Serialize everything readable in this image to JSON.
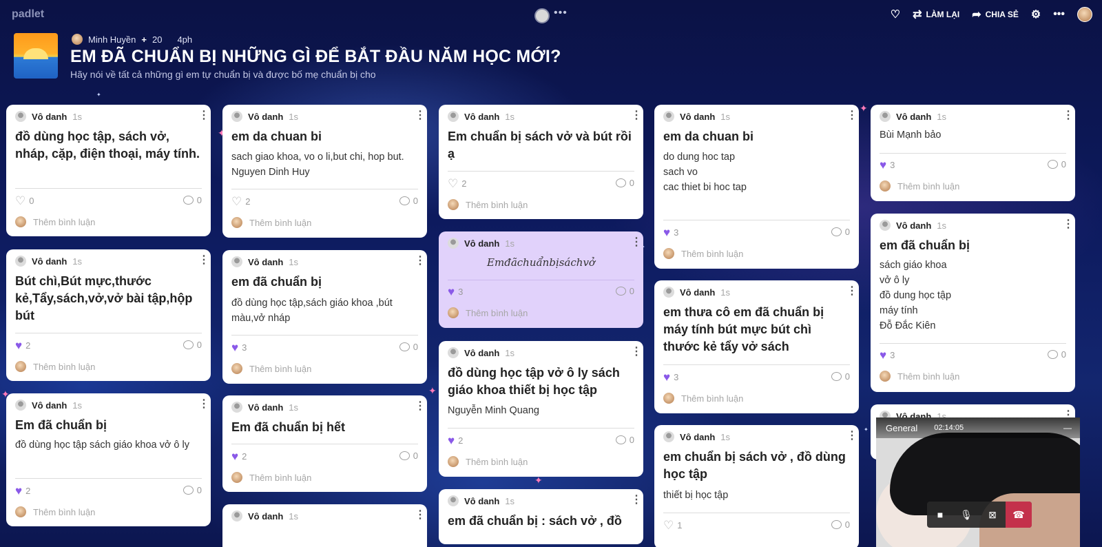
{
  "app": {
    "brand": "padlet"
  },
  "topbar": {
    "actions": [
      {
        "icon": "heart-outline-icon",
        "label": ""
      },
      {
        "icon": "remake-icon",
        "label": "LÀM LẠI"
      },
      {
        "icon": "share-icon",
        "label": "CHIA SẺ"
      },
      {
        "icon": "gear-icon",
        "label": ""
      },
      {
        "icon": "more-icon",
        "label": ""
      }
    ]
  },
  "header": {
    "author": "Minh Huyền",
    "contributors": "20",
    "time": "4ph",
    "title": "EM ĐÃ CHUẨN BỊ NHỮNG GÌ ĐỂ BẮT ĐẦU NĂM HỌC MỚI?",
    "subtitle": "Hãy nói về tất cả những gì em tự chuẩn bị và được bố mẹ chuẩn bị cho"
  },
  "common": {
    "author": "Vô danh",
    "time": "1s",
    "comment_placeholder": "Thêm bình luận"
  },
  "cards": [
    {
      "title": "đồ dùng học tập, sách vở, nháp, cặp, điện thoại, máy tính.",
      "body": "",
      "likes": "0",
      "comments": "0"
    },
    {
      "title": "Bút chì,Bút mực,thước kẻ,Tẩy,sách,vở,vở bài tập,hộp bút",
      "body": "",
      "likes": "2",
      "comments": "0"
    },
    {
      "title": "Em đã chuẩn bị",
      "body": "đồ dùng học tập sách giáo khoa vở ô ly",
      "likes": "2",
      "comments": "0"
    },
    {
      "title": "em da chuan bi",
      "body": "sach giao khoa, vo o li,but chi, hop but.\nNguyen Dinh Huy",
      "likes": "2",
      "comments": "0"
    },
    {
      "title": "em đã chuẩn bị",
      "body": "đồ dùng học tập,sách giáo khoa ,bút màu,vở nháp",
      "likes": "3",
      "comments": "0"
    },
    {
      "title": "Em đã chuẩn bị hết",
      "body": "",
      "likes": "2",
      "comments": "0"
    },
    {
      "title": "",
      "body": "",
      "likes": "",
      "comments": ""
    },
    {
      "title": "Em chuẩn bị sách vở và bút rồi ạ",
      "body": "",
      "likes": "2",
      "comments": "0"
    },
    {
      "title": "",
      "body": "Emđãchuẩnbịsáchvở",
      "likes": "3",
      "comments": "0"
    },
    {
      "title": "đồ dùng học tập vở ô ly sách giáo khoa thiết bị học tập",
      "body": "Nguyễn Minh Quang",
      "likes": "2",
      "comments": "0"
    },
    {
      "title": "em đã chuẩn bị : sách vở , đồ",
      "body": "",
      "likes": "",
      "comments": ""
    },
    {
      "title": "em da chuan bi",
      "body": "do dung hoc tap\nsach vo\ncac thiet bi hoc tap",
      "likes": "3",
      "comments": "0"
    },
    {
      "title": "em thưa cô em đã chuẩn bị máy tính bút mực bút chì thước kẻ tẩy vở sách",
      "body": "",
      "likes": "3",
      "comments": "0"
    },
    {
      "title": "em chuẩn bị sách vở , đồ dùng học tập",
      "body": "thiết bị học tập",
      "likes": "1",
      "comments": "0"
    },
    {
      "title": "",
      "body": "Bùi Mạnh bảo",
      "likes": "3",
      "comments": "0"
    },
    {
      "title": "em đã chuẩn bị",
      "body": "sách giáo khoa\nvở ô ly\nđồ dung học tập\nmáy tính\n Đỗ Đắc Kiên",
      "likes": "3",
      "comments": "0"
    },
    {
      "title": "",
      "body": "",
      "likes": "",
      "comments": ""
    }
  ],
  "call": {
    "channel": "General",
    "timer": "02:14:05"
  }
}
